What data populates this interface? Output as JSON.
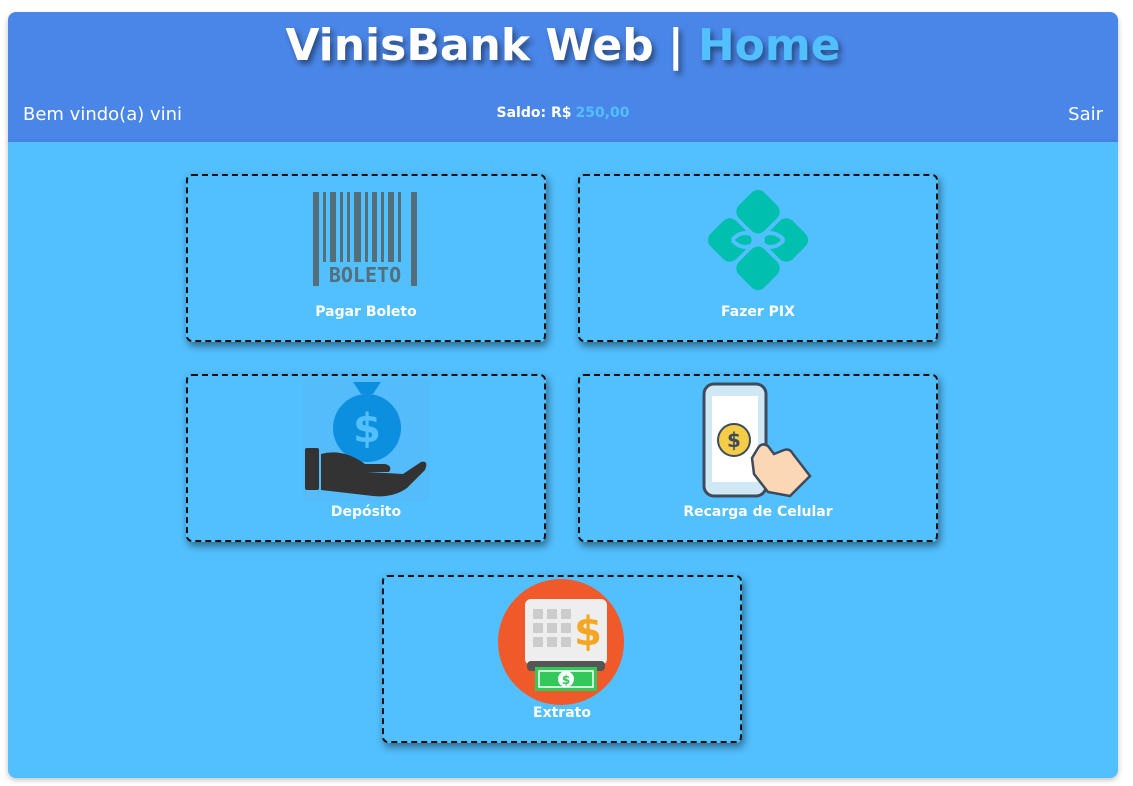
{
  "header": {
    "app_title": "VinisBank Web",
    "separator": "|",
    "page_title": "Home",
    "welcome": "Bem vindo(a) vini",
    "saldo_label": "Saldo: R$",
    "saldo_value": "250,00",
    "logout_label": "Sair"
  },
  "cards": {
    "boleto": {
      "label": "Pagar Boleto",
      "icon_text": "BOLETO",
      "icon": "barcode-icon"
    },
    "pix": {
      "label": "Fazer PIX",
      "icon": "pix-icon"
    },
    "deposito": {
      "label": "Depósito",
      "icon": "money-bag-hand-icon"
    },
    "recarga": {
      "label": "Recarga de Celular",
      "icon": "phone-payment-icon"
    },
    "extrato": {
      "label": "Extrato",
      "icon": "atm-cash-icon"
    }
  },
  "colors": {
    "header_bg": "#4a86e8",
    "main_bg": "#52bffe",
    "accent": "#52bffe",
    "pix_green": "#32bcad"
  }
}
